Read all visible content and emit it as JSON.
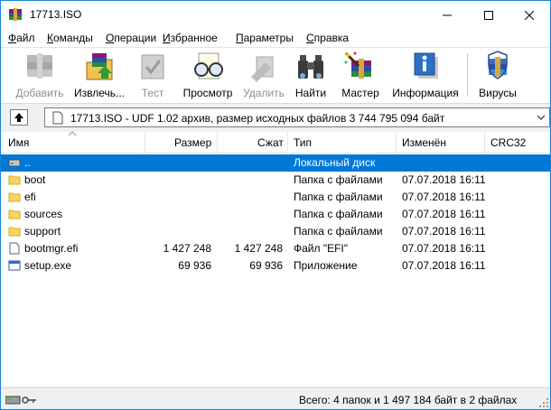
{
  "window": {
    "title": "17713.ISO"
  },
  "menu": [
    {
      "label": "Файл",
      "u": "Ф",
      "rest": "айл"
    },
    {
      "label": "Команды",
      "u": "К",
      "rest": "оманды"
    },
    {
      "label": "Операции",
      "u": "О",
      "rest": "перации"
    },
    {
      "label": "Избранное",
      "u": "И",
      "rest": "збранное"
    },
    {
      "label": "Параметры",
      "u": "П",
      "rest": "араметры"
    },
    {
      "label": "Справка",
      "u": "С",
      "rest": "правка"
    }
  ],
  "toolbar": {
    "add": "Добавить",
    "extract": "Извлечь...",
    "test": "Тест",
    "view": "Просмотр",
    "delete": "Удалить",
    "find": "Найти",
    "wizard": "Мастер",
    "info": "Информация",
    "virus": "Вирусы"
  },
  "address": {
    "text": "17713.ISO - UDF 1.02 архив, размер исходных файлов 3 744 795 094 байт"
  },
  "columns": {
    "name": "Имя",
    "size": "Размер",
    "packed": "Сжат",
    "type": "Тип",
    "modified": "Изменён",
    "crc": "CRC32"
  },
  "files": [
    {
      "name": "..",
      "size": "",
      "packed": "",
      "type": "Локальный диск",
      "modified": "",
      "icon": "disk-icon",
      "selected": true
    },
    {
      "name": "boot",
      "size": "",
      "packed": "",
      "type": "Папка с файлами",
      "modified": "07.07.2018 16:11",
      "icon": "folder-icon"
    },
    {
      "name": "efi",
      "size": "",
      "packed": "",
      "type": "Папка с файлами",
      "modified": "07.07.2018 16:11",
      "icon": "folder-icon"
    },
    {
      "name": "sources",
      "size": "",
      "packed": "",
      "type": "Папка с файлами",
      "modified": "07.07.2018 16:11",
      "icon": "folder-icon"
    },
    {
      "name": "support",
      "size": "",
      "packed": "",
      "type": "Папка с файлами",
      "modified": "07.07.2018 16:11",
      "icon": "folder-icon"
    },
    {
      "name": "bootmgr.efi",
      "size": "1 427 248",
      "packed": "1 427 248",
      "type": "Файл \"EFI\"",
      "modified": "07.07.2018 16:11",
      "icon": "file-icon"
    },
    {
      "name": "setup.exe",
      "size": "69 936",
      "packed": "69 936",
      "type": "Приложение",
      "modified": "07.07.2018 16:11",
      "icon": "exe-icon"
    }
  ],
  "status": {
    "text": "Всего: 4 папок и 1 497 184 байт в 2 файлах"
  },
  "colors": {
    "selection": "#0078d7",
    "folder": "#ffd35c",
    "accent": "#1883d7"
  }
}
